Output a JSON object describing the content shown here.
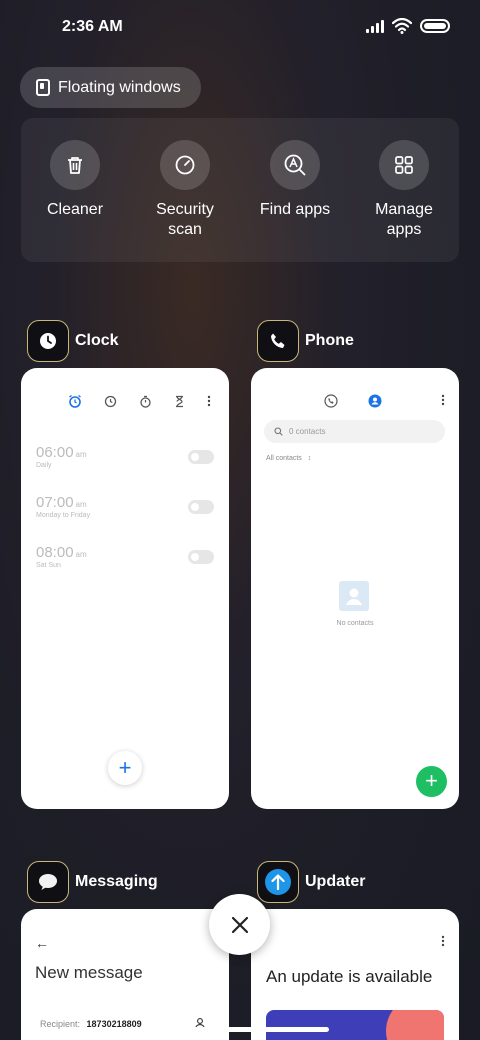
{
  "status_bar": {
    "time": "2:36 AM"
  },
  "floating_windows": {
    "label": "Floating windows"
  },
  "quick_actions": [
    {
      "label": "Cleaner",
      "icon": "trash-icon"
    },
    {
      "label": "Security\nscan",
      "icon": "security-scan-icon"
    },
    {
      "label": "Find apps",
      "icon": "find-apps-icon"
    },
    {
      "label": "Manage\napps",
      "icon": "grid-icon"
    }
  ],
  "apps": {
    "clock": {
      "title": "Clock",
      "alarms": [
        {
          "time": "06:00",
          "ampm": "am",
          "repeat": "Daily"
        },
        {
          "time": "07:00",
          "ampm": "am",
          "repeat": "Monday to Friday"
        },
        {
          "time": "08:00",
          "ampm": "am",
          "repeat": "Sat Sun"
        }
      ],
      "add_symbol": "+"
    },
    "phone": {
      "title": "Phone",
      "search_placeholder": "0 contacts",
      "filter_label": "All contacts",
      "empty_label": "No contacts",
      "add_symbol": "+"
    },
    "messaging": {
      "title": "Messaging",
      "screen_title": "New message",
      "recipient_label": "Recipient:",
      "recipient_value": "18730218809"
    },
    "updater": {
      "title": "Updater",
      "headline": "An update is available"
    }
  },
  "colors": {
    "accent_blue": "#1a73e8",
    "accent_green": "#1dbf62",
    "icon_border": "#c9b77a"
  }
}
